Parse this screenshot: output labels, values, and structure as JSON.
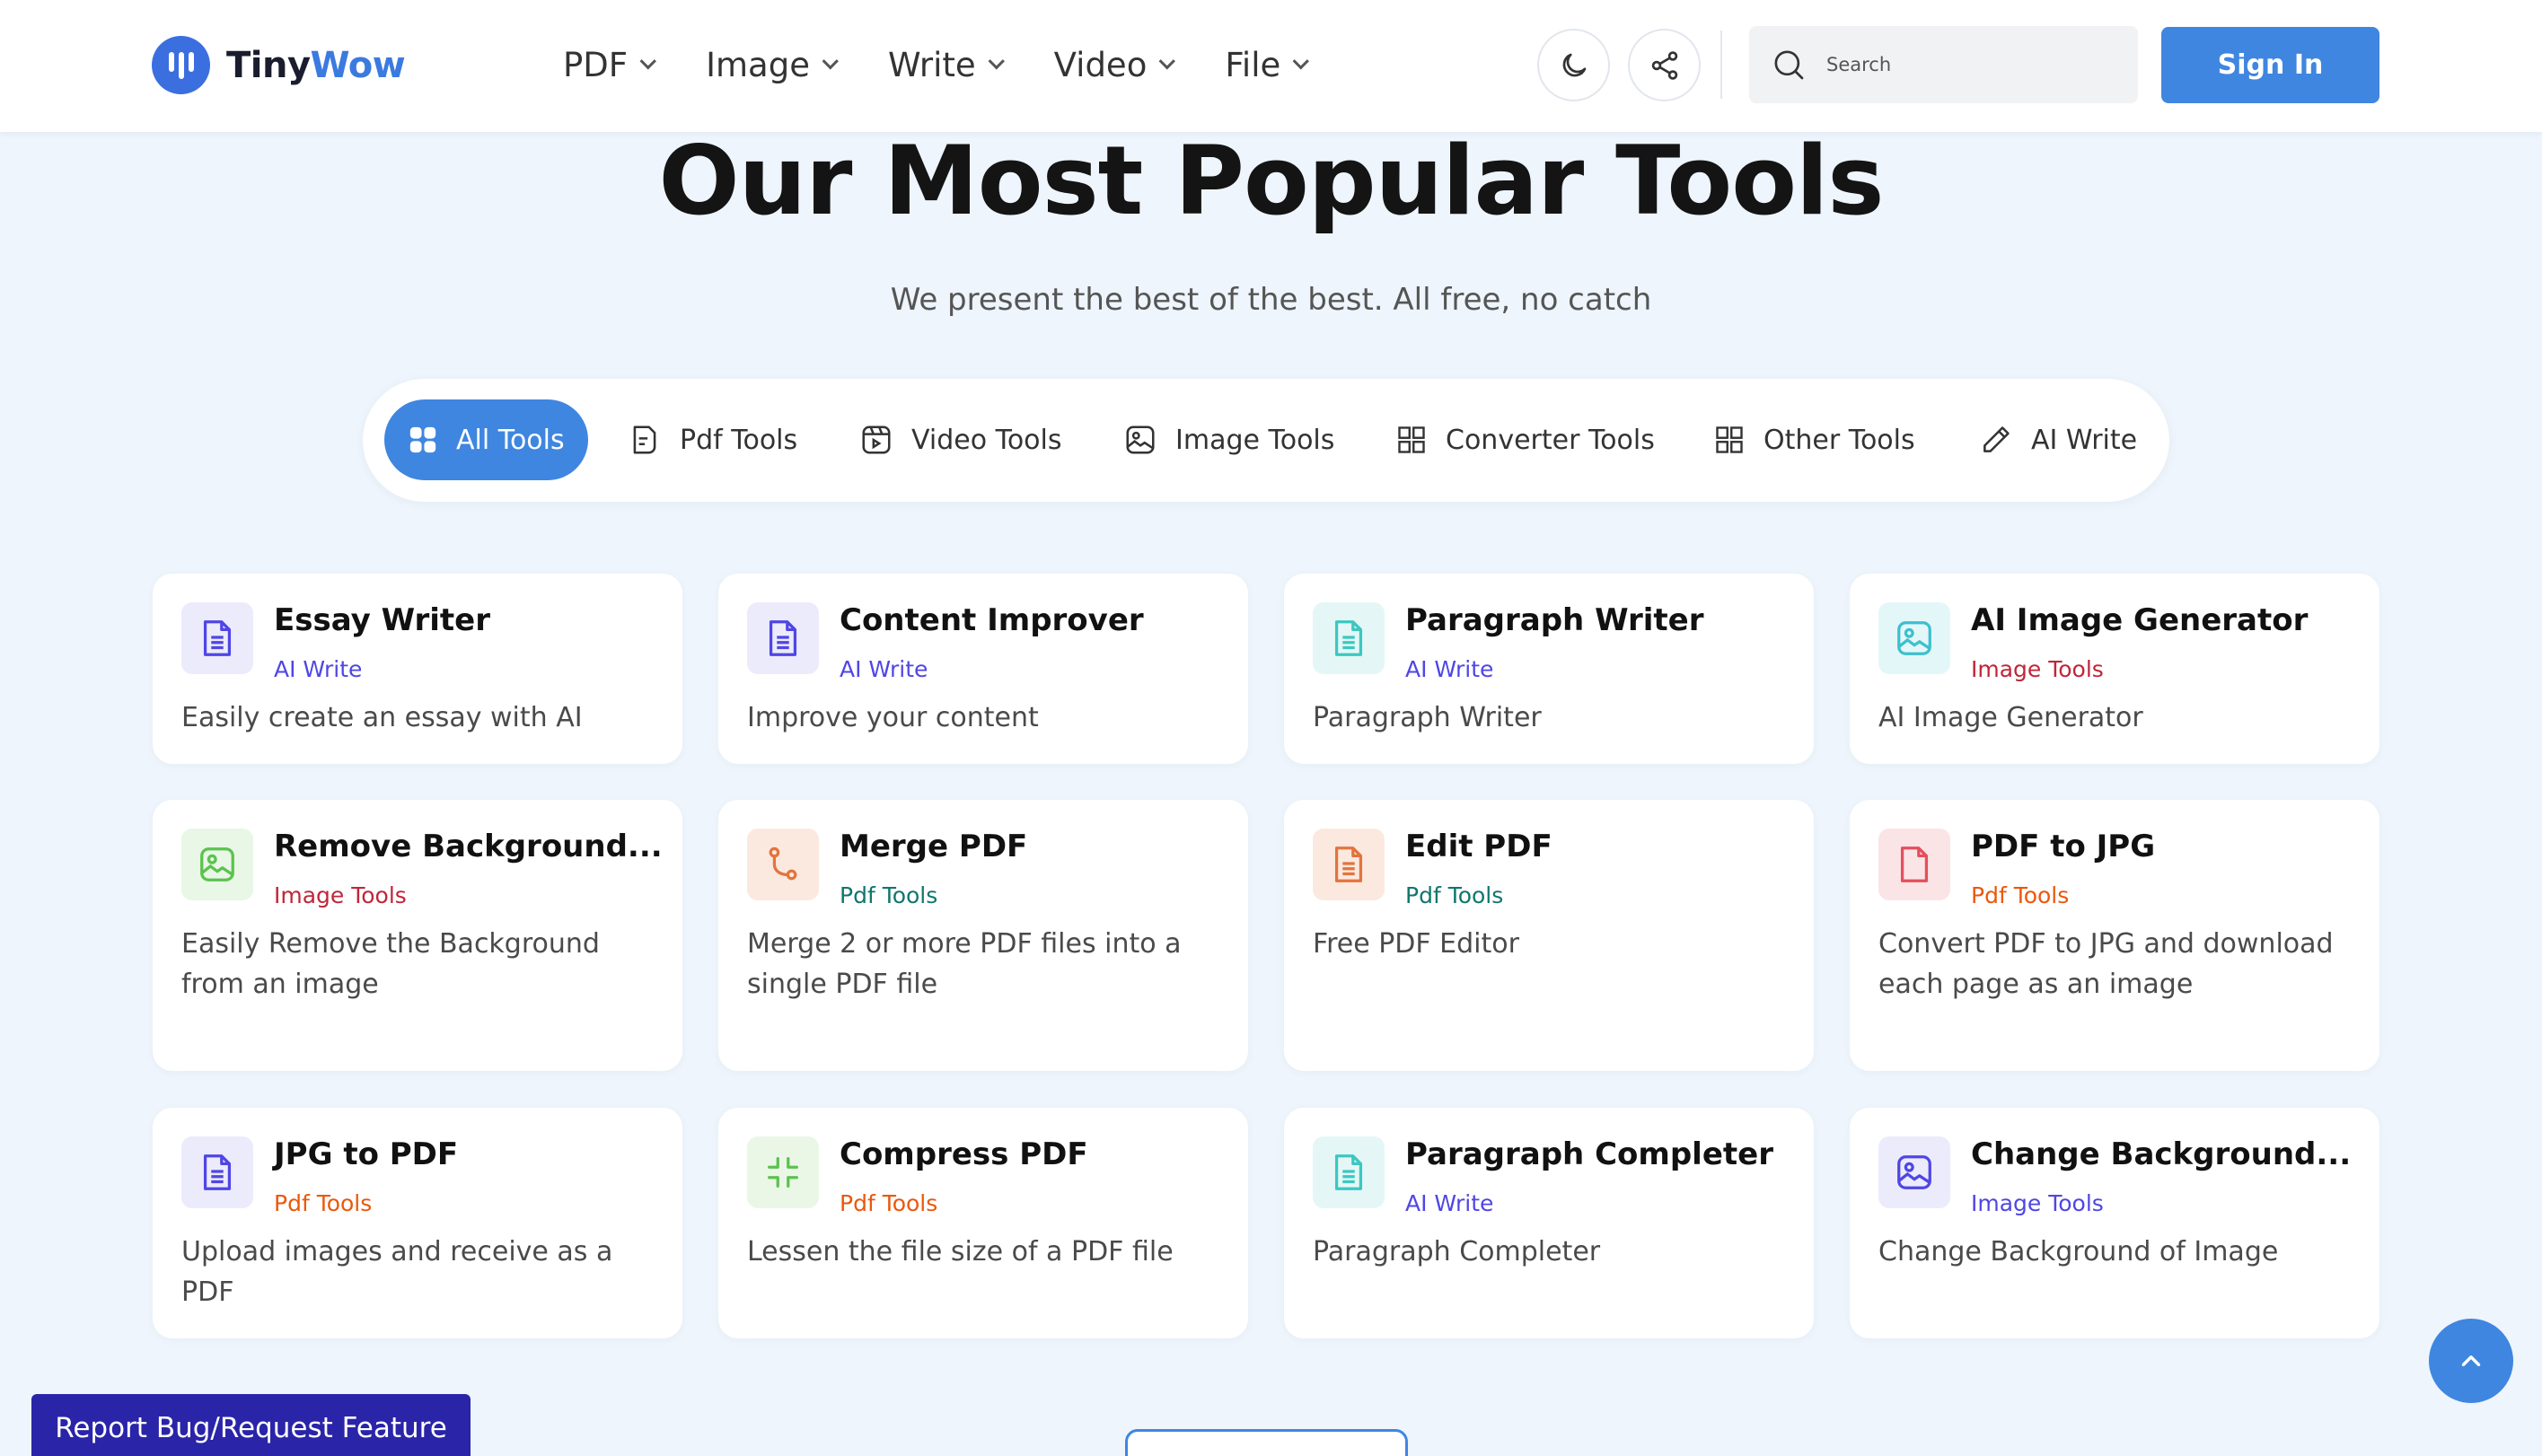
{
  "brand": {
    "name_part1": "Tiny",
    "name_part2": "Wow",
    "color": "#3b6fe0"
  },
  "nav": [
    "PDF",
    "Image",
    "Write",
    "Video",
    "File"
  ],
  "header": {
    "search_placeholder": "Search",
    "sign_in": "Sign In"
  },
  "hero": {
    "title": "Our Most Popular Tools",
    "subtitle": "We present the best of the best. All free, no catch"
  },
  "tabs": [
    {
      "label": "All Tools",
      "icon": "grid-dots-icon",
      "active": true
    },
    {
      "label": "Pdf Tools",
      "icon": "pdf-file-icon",
      "active": false
    },
    {
      "label": "Video Tools",
      "icon": "video-icon",
      "active": false
    },
    {
      "label": "Image Tools",
      "icon": "image-icon",
      "active": false
    },
    {
      "label": "Converter Tools",
      "icon": "grid-icon",
      "active": false
    },
    {
      "label": "Other Tools",
      "icon": "grid-icon",
      "active": false
    },
    {
      "label": "AI Write",
      "icon": "pencil-icon",
      "active": false
    }
  ],
  "tools": [
    {
      "title": "Essay Writer",
      "category": "AI Write",
      "desc": "Easily create an essay with AI",
      "icon": "document-icon"
    },
    {
      "title": "Content Improver",
      "category": "AI Write",
      "desc": "Improve your content",
      "icon": "document-icon"
    },
    {
      "title": "Paragraph Writer",
      "category": "AI Write",
      "desc": "Paragraph Writer",
      "icon": "document-icon"
    },
    {
      "title": "AI Image Generator",
      "category": "Image Tools",
      "desc": "AI Image Generator",
      "icon": "image-icon"
    },
    {
      "title": "Remove Background...",
      "category": "Image Tools",
      "desc": "Easily Remove the Background from an image",
      "icon": "image-icon"
    },
    {
      "title": "Merge PDF",
      "category": "Pdf Tools",
      "desc": "Merge 2 or more PDF files into a single PDF file",
      "icon": "merge-icon"
    },
    {
      "title": "Edit PDF",
      "category": "Pdf Tools",
      "desc": "Free PDF Editor",
      "icon": "document-icon"
    },
    {
      "title": "PDF to JPG",
      "category": "Pdf Tools",
      "desc": "Convert PDF to JPG and download each page as an image",
      "icon": "file-icon"
    },
    {
      "title": "JPG to PDF",
      "category": "Pdf Tools",
      "desc": "Upload images and receive as a PDF",
      "icon": "document-icon"
    },
    {
      "title": "Compress PDF",
      "category": "Pdf Tools",
      "desc": "Lessen the file size of a PDF file",
      "icon": "compress-icon"
    },
    {
      "title": "Paragraph Completer",
      "category": "AI Write",
      "desc": "Paragraph Completer",
      "icon": "document-icon"
    },
    {
      "title": "Change Background...",
      "category": "Image Tools",
      "desc": "Change Background of Image",
      "icon": "image-icon"
    }
  ],
  "footer": {
    "report": "Report Bug/Request Feature"
  },
  "colors": {
    "accent": "#3f86e0",
    "ai_write": "#4f46e5",
    "image_tools": "#c0263a",
    "pdf_tools_orange": "#ea580c",
    "pdf_tools_teal": "#0f766e",
    "report_bg": "#2a24a8"
  }
}
